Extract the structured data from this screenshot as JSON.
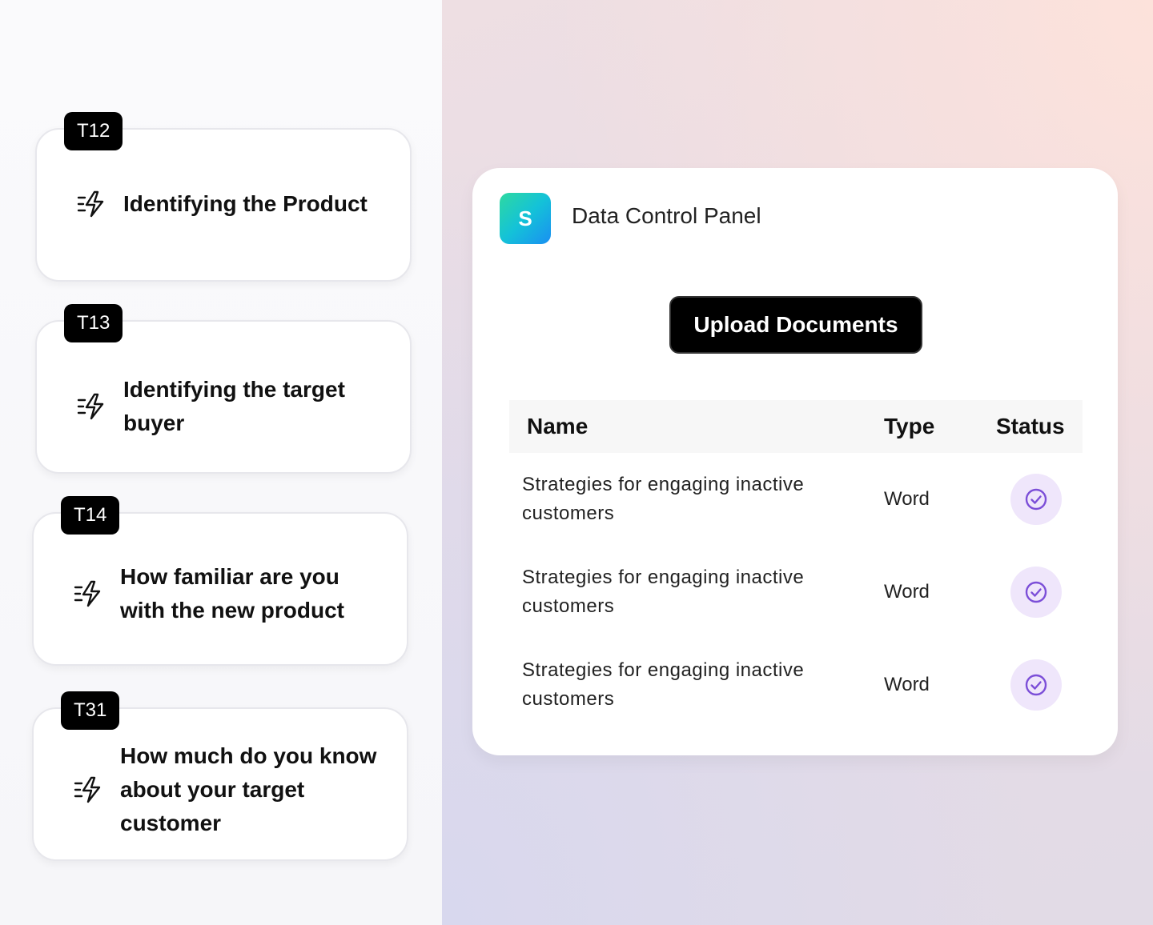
{
  "tasks": [
    {
      "tag": "T12",
      "title": "Identifying the Product",
      "icon": "flash-icon"
    },
    {
      "tag": "T13",
      "title": "Identifying the target buyer",
      "icon": "flash-icon"
    },
    {
      "tag": "T14",
      "title": "How familiar are you with the new product",
      "icon": "flash-icon"
    },
    {
      "tag": "T31",
      "title": "How much do you know about your target customer",
      "icon": "flash-icon"
    }
  ],
  "panel": {
    "logo_letter": "S",
    "title": "Data Control Panel",
    "upload_label": "Upload Documents",
    "columns": {
      "name": "Name",
      "type": "Type",
      "status": "Status"
    },
    "rows": [
      {
        "name": "Strategies for engaging inactive customers",
        "type": "Word",
        "status": "check-circle-icon"
      },
      {
        "name": "Strategies for engaging inactive customers",
        "type": "Word",
        "status": "check-circle-icon"
      },
      {
        "name": "Strategies for engaging inactive customers",
        "type": "Word",
        "status": "check-circle-icon"
      }
    ]
  },
  "colors": {
    "status_bg": "#efe6fb",
    "status_check": "#7c4fd8",
    "logo_gradient_start": "#2ed9a0",
    "logo_gradient_end": "#1a8ff2"
  }
}
